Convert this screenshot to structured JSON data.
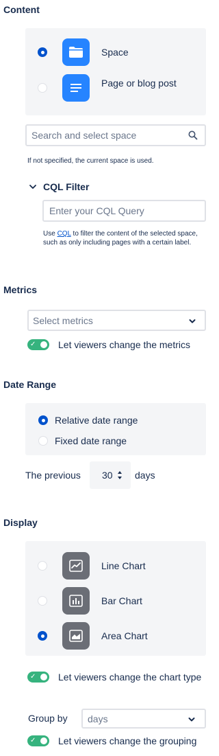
{
  "content": {
    "title": "Content",
    "options": [
      {
        "label": "Space"
      },
      {
        "label": "Page or blog post"
      }
    ],
    "space_search_placeholder": "Search and select space",
    "space_hint": "If not specified, the current space is used.",
    "cql": {
      "title": "CQL Filter",
      "placeholder": "Enter your CQL Query",
      "help_prefix": "Use ",
      "help_link": "CQL",
      "help_suffix": " to filter the content of the selected space, such as only including pages with a certain label."
    }
  },
  "metrics": {
    "title": "Metrics",
    "select_placeholder": "Select metrics",
    "toggle_label": "Let viewers change the metrics"
  },
  "date_range": {
    "title": "Date Range",
    "options": [
      {
        "label": "Relative date range"
      },
      {
        "label": "Fixed date range"
      }
    ],
    "previous_label": "The previous",
    "previous_value": "30",
    "unit_label": "days"
  },
  "display": {
    "title": "Display",
    "options": [
      {
        "label": "Line Chart"
      },
      {
        "label": "Bar Chart"
      },
      {
        "label": "Area Chart"
      }
    ],
    "chart_toggle_label": "Let viewers change the chart type",
    "group_by_label": "Group by",
    "group_by_value": "days",
    "grouping_toggle_label": "Let viewers change the grouping"
  }
}
